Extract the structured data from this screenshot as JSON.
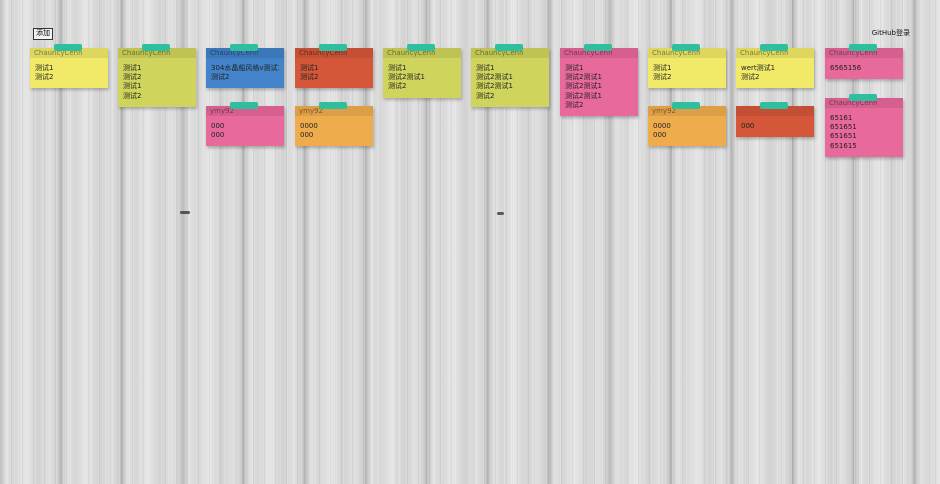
{
  "toolbar": {
    "add_label": "添加",
    "login_label": "GitHub登录"
  },
  "colors": {
    "yellow": "#f1ea68",
    "olive": "#cfd45c",
    "blue": "#4283c9",
    "red": "#d4573a",
    "pink": "#e8699c",
    "orange": "#efac4d",
    "tape": "#2fbf9f"
  },
  "notes": [
    {
      "author": "ChauncyCenn",
      "lines": [
        "测试1",
        "测试2"
      ],
      "color": "yellow"
    },
    {
      "author": "ChauncyCenn",
      "lines": [
        "测试1",
        "测试2",
        "测试1",
        "测试2"
      ],
      "color": "olive"
    },
    {
      "author": "ChauncyCenn",
      "lines": [
        "304水晶船风格v测试1",
        "测试2"
      ],
      "color": "blue"
    },
    {
      "author": "ymy92",
      "lines": [
        "000",
        "000"
      ],
      "color": "pink"
    },
    {
      "author": "ChauncyCenn",
      "lines": [
        "测试1",
        "测试2"
      ],
      "color": "red"
    },
    {
      "author": "ymy92",
      "lines": [
        "0000",
        "000"
      ],
      "color": "orange"
    },
    {
      "author": "ChauncyCenn",
      "lines": [
        "测试1",
        "测试2测试1",
        "测试2"
      ],
      "color": "olive"
    },
    {
      "author": "ChauncyCenn",
      "lines": [
        "测试1",
        "测试2测试1",
        "测试2测试1",
        "测试2"
      ],
      "color": "olive"
    },
    {
      "author": "ChauncyCenn",
      "lines": [
        "测试1",
        "测试2测试1",
        "测试2测试1",
        "测试2测试1",
        "测试2"
      ],
      "color": "pink"
    },
    {
      "author": "ChauncyCenn",
      "lines": [
        "测试1",
        "测试2"
      ],
      "color": "yellow"
    },
    {
      "author": "ymy92",
      "lines": [
        "0000",
        "000"
      ],
      "color": "orange"
    },
    {
      "author": "ChauncyCenn",
      "lines": [
        "wert测试1",
        "测试2"
      ],
      "color": "yellow"
    },
    {
      "author": "",
      "lines": [
        "000"
      ],
      "color": "red"
    },
    {
      "author": "ChauncyCenn",
      "lines": [
        "6565156"
      ],
      "color": "pink"
    },
    {
      "author": "ChauncyCenn",
      "lines": [
        "65161",
        "651651",
        "651651",
        "651615"
      ],
      "color": "pink"
    }
  ]
}
